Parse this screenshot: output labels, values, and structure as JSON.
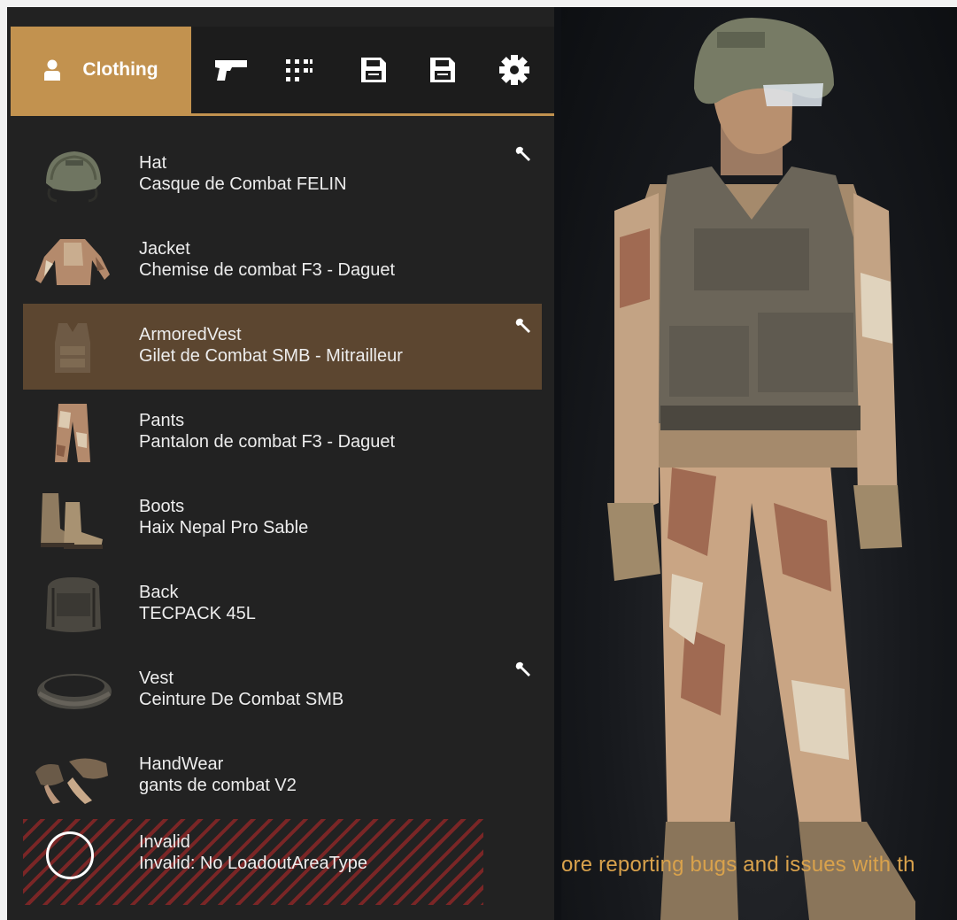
{
  "tabs": {
    "active_label": "Clothing",
    "icons": [
      "person-icon",
      "pistol-icon",
      "grid-icon",
      "save-icon",
      "save-icon",
      "gear-icon"
    ]
  },
  "colors": {
    "accent": "#c2924f",
    "selected_row": "#5c4630",
    "panel": "#222222",
    "ticker_text": "#d9a24c"
  },
  "items": [
    {
      "slot": "Hat",
      "name": "Casque de Combat FELIN"
    },
    {
      "slot": "Jacket",
      "name": "Chemise de combat F3 - Daguet"
    },
    {
      "slot": "ArmoredVest",
      "name": "Gilet de Combat SMB - Mitrailleur"
    },
    {
      "slot": "Pants",
      "name": "Pantalon de combat F3 - Daguet"
    },
    {
      "slot": "Boots",
      "name": "Haix Nepal Pro Sable"
    },
    {
      "slot": "Back",
      "name": "TECPACK 45L"
    },
    {
      "slot": "Vest",
      "name": "Ceinture De Combat SMB"
    },
    {
      "slot": "HandWear",
      "name": "gants de combat V2"
    },
    {
      "slot": "Invalid",
      "name": "Invalid: No LoadoutAreaType"
    }
  ],
  "ticker": {
    "text": "ore reporting bugs and issues with th"
  }
}
